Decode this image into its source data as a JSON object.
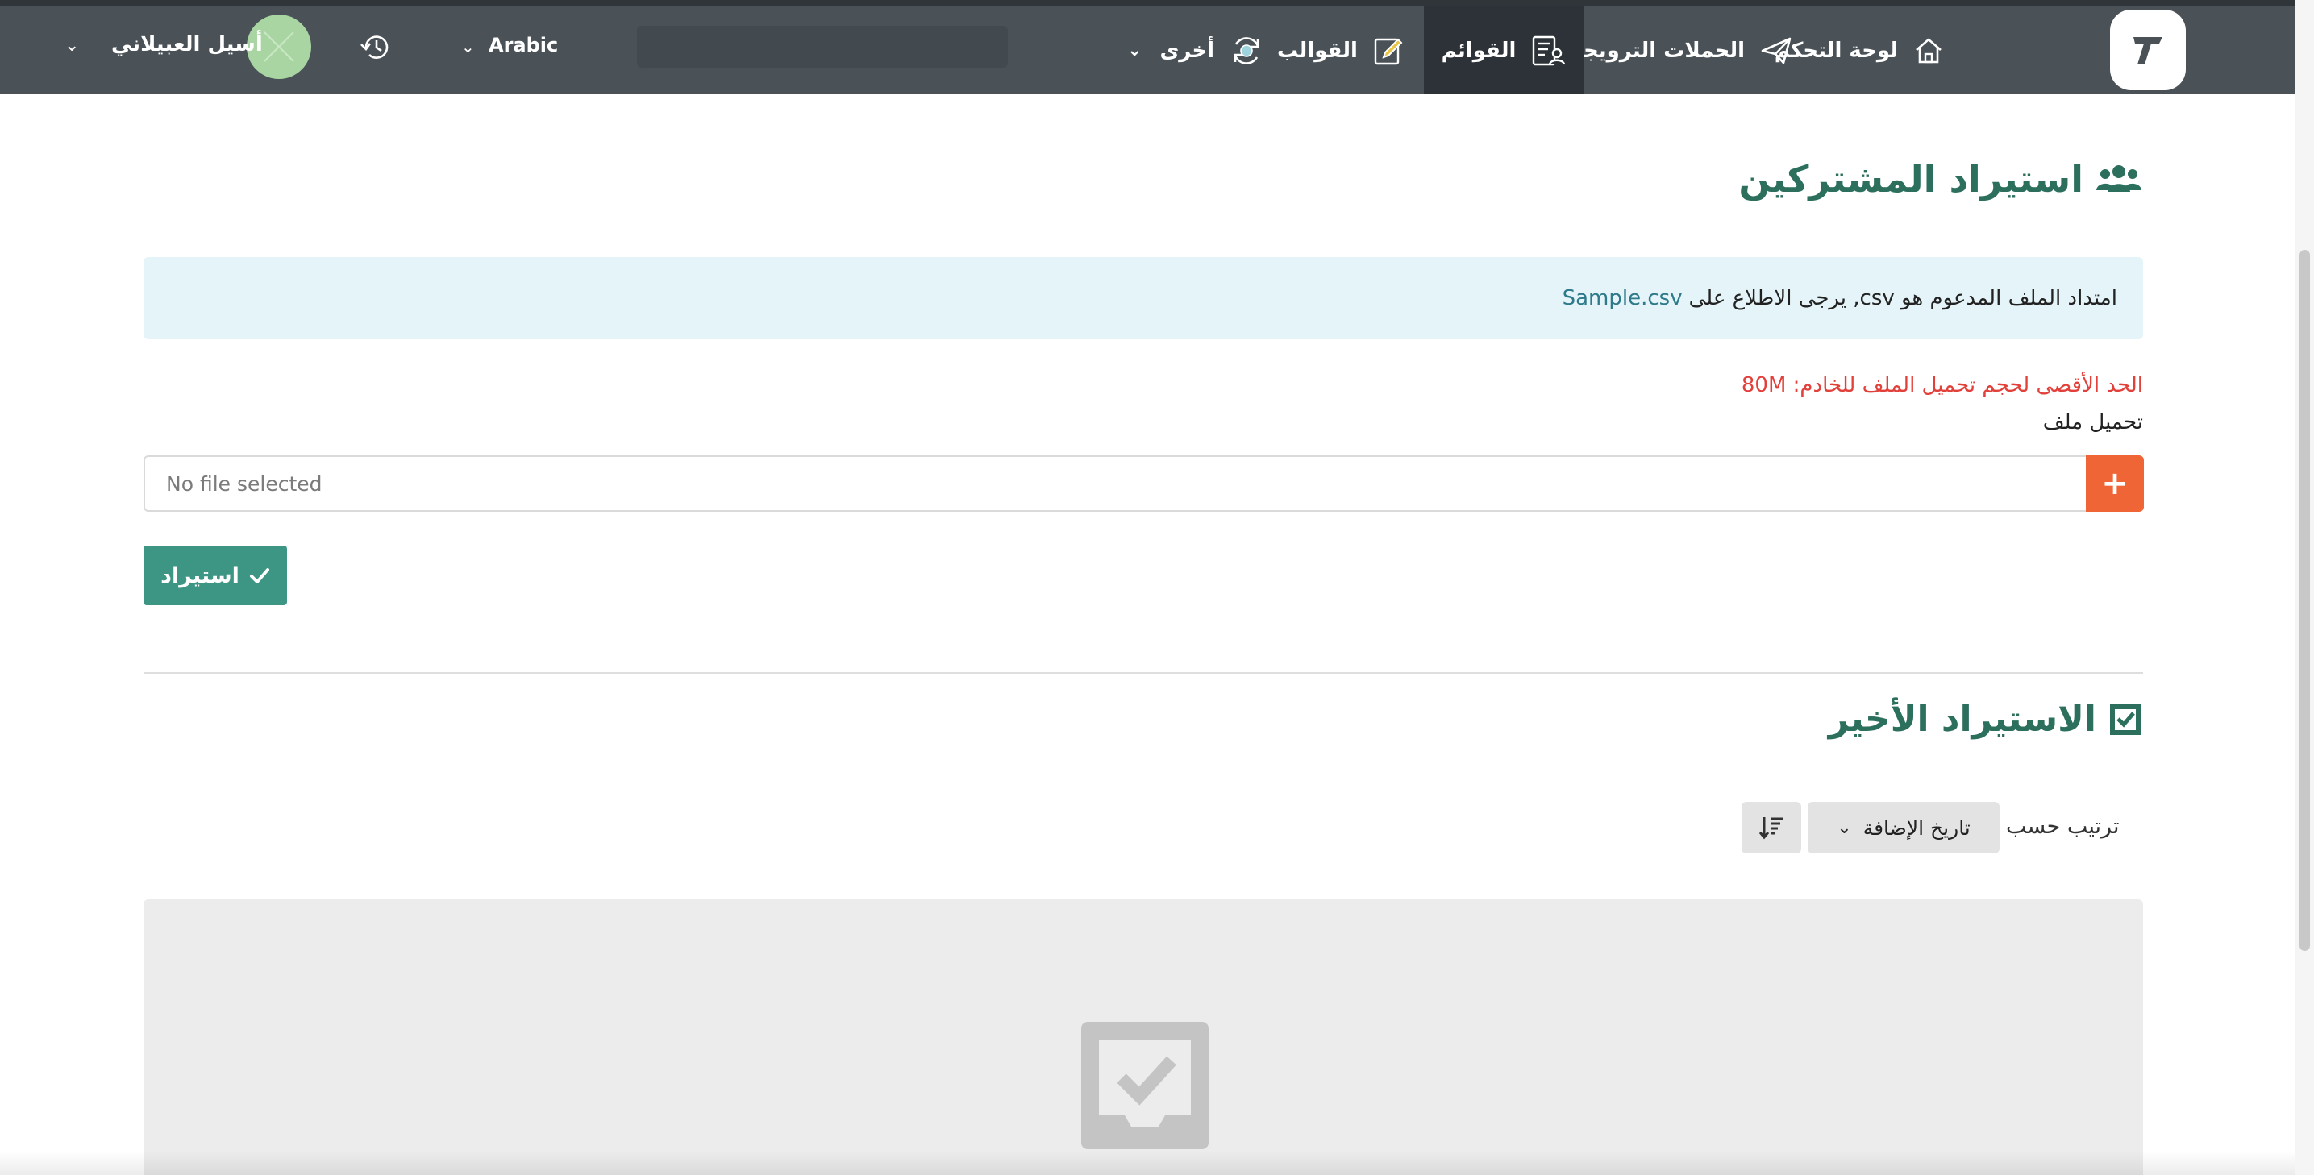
{
  "nav": {
    "items": [
      {
        "label": "لوحة التحكم",
        "icon": "home-icon"
      },
      {
        "label": "الحملات الترويجية",
        "icon": "send-icon"
      },
      {
        "label": "القوائم",
        "icon": "list-users-icon",
        "active": true
      },
      {
        "label": "القوالب",
        "icon": "template-edit-icon"
      },
      {
        "label": "أخرى",
        "icon": "refresh-cycle-icon"
      }
    ],
    "language": "Arabic",
    "user_name": "أسيل العبيلاني"
  },
  "page": {
    "title": "استيراد المشتركين",
    "info_text": "امتداد الملف المدعوم هو csv, يرجى الاطلاع على",
    "info_link": "Sample.csv",
    "limit_text": "الحد الأقصى لحجم تحميل الملف للخادم: 80M",
    "upload_label": "تحميل ملف",
    "file_placeholder": "No file selected",
    "add_file_symbol": "+",
    "import_button": "استيراد",
    "recent_title": "الاستيراد الأخير",
    "sort_label": "ترتيب حسب",
    "sort_value": "تاريخ الإضافة"
  },
  "colors": {
    "nav_bg": "#4a5258",
    "nav_active_bg": "#2c3237",
    "title_green": "#2c6f5d",
    "info_bg": "#e4f4f8",
    "limit_red": "#e2403a",
    "add_orange": "#ef6535",
    "import_green": "#3d9583",
    "avatar_green": "#a8d5a2"
  }
}
